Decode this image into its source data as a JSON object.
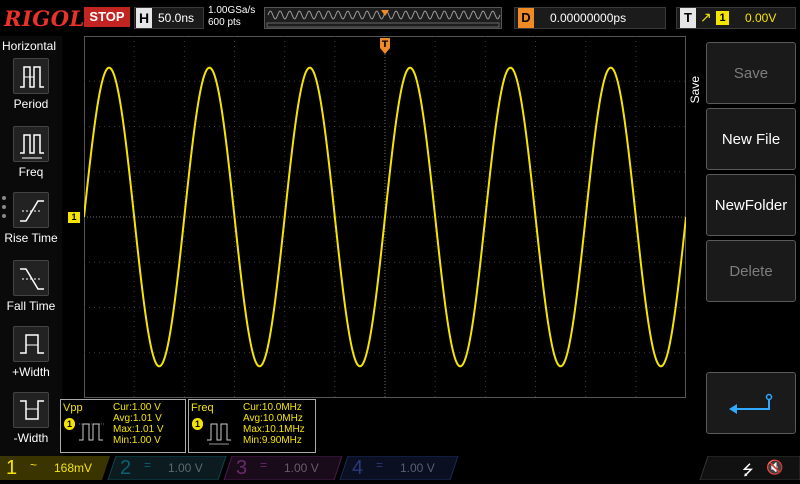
{
  "brand": "RIGOL",
  "run_state": "STOP",
  "horizontal": {
    "label": "H",
    "timebase": "50.0ns",
    "sample_rate": "1.00GSa/s",
    "points": "600 pts"
  },
  "delay": {
    "label": "D",
    "value": "0.00000000ps"
  },
  "trigger": {
    "label": "T",
    "source": "1",
    "level": "0.00V"
  },
  "left_menu": {
    "title": "Horizontal",
    "items": [
      {
        "label": "Period"
      },
      {
        "label": "Freq"
      },
      {
        "label": "Rise Time"
      },
      {
        "label": "Fall Time"
      },
      {
        "label": "+Width"
      },
      {
        "label": "-Width"
      }
    ]
  },
  "right_menu": {
    "title": "Save",
    "buttons": [
      {
        "label": "Save",
        "enabled": false
      },
      {
        "label": "New File",
        "enabled": true
      },
      {
        "label": "NewFolder",
        "enabled": true
      },
      {
        "label": "Delete",
        "enabled": false
      }
    ]
  },
  "measurements": [
    {
      "name": "Vpp",
      "channel": "1",
      "cur": "Cur:1.00 V",
      "avg": "Avg:1.01 V",
      "max": "Max:1.01 V",
      "min": "Min:1.00 V"
    },
    {
      "name": "Freq",
      "channel": "1",
      "cur": "Cur:10.0MHz",
      "avg": "Avg:10.0MHz",
      "max": "Max:10.1MHz",
      "min": "Min:9.90MHz"
    }
  ],
  "channels": [
    {
      "num": "1",
      "coupling": "~",
      "scale": "168mV",
      "active": true
    },
    {
      "num": "2",
      "coupling": "=",
      "scale": "1.00 V",
      "active": false
    },
    {
      "num": "3",
      "coupling": "=",
      "scale": "1.00 V",
      "active": false
    },
    {
      "num": "4",
      "coupling": "=",
      "scale": "1.00 V",
      "active": false
    }
  ],
  "waveform": {
    "channel": "1",
    "cycles": 6,
    "amplitude_divs": 3.3
  },
  "colors": {
    "ch1": "#f5e400",
    "ch2": "#00c8e8",
    "ch3": "#e040e0",
    "ch4": "#2f7bff",
    "trigger": "#f08a24",
    "stop": "#c22421",
    "brand": "#e8322a"
  }
}
